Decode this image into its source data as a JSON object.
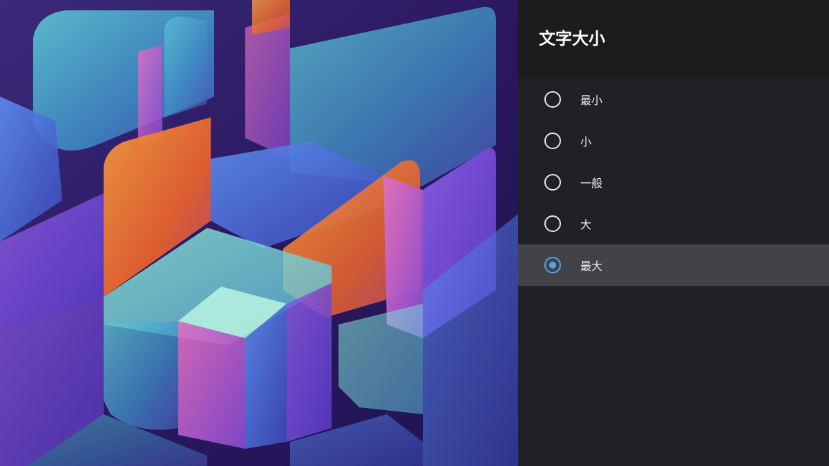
{
  "panel": {
    "title": "文字大小",
    "options": [
      {
        "label": "最小",
        "selected": false
      },
      {
        "label": "小",
        "selected": false
      },
      {
        "label": "一般",
        "selected": false
      },
      {
        "label": "大",
        "selected": false
      },
      {
        "label": "最大",
        "selected": true
      }
    ]
  },
  "colors": {
    "panel_background": "#202124",
    "header_background": "#1b1c1e",
    "selected_row": "#424346",
    "accent": "#4fa3f7",
    "text": "#e8eaed"
  }
}
